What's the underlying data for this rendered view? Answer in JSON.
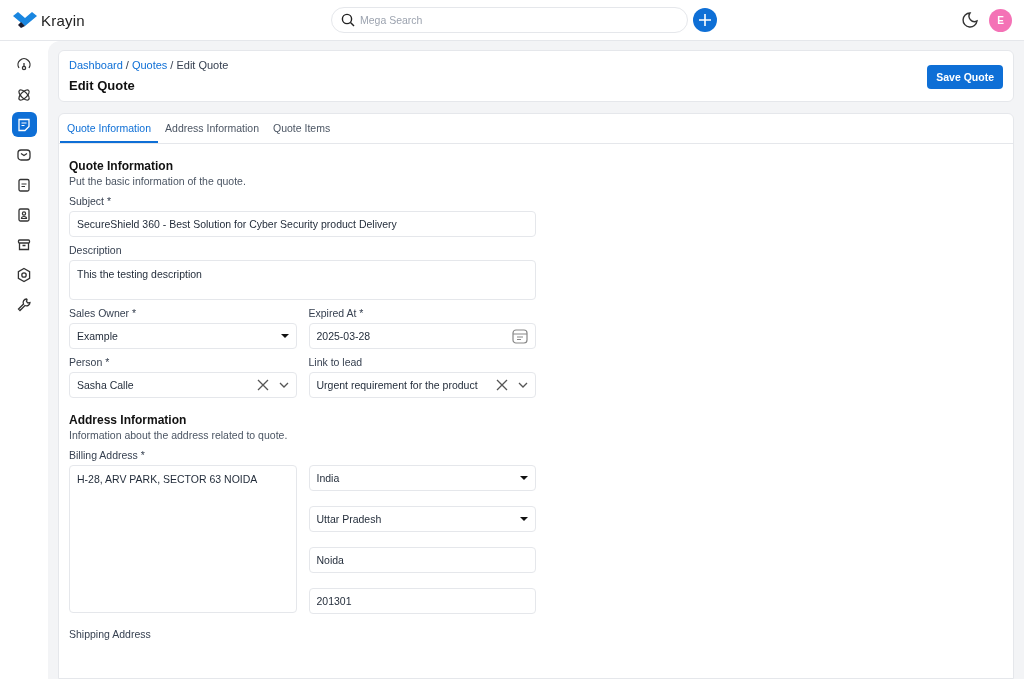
{
  "topbar": {
    "logo": "Krayin",
    "search": {
      "placeholder": "Mega Search"
    },
    "avatar": "E"
  },
  "sidebar": {
    "items": [
      {
        "selected": false
      },
      {
        "selected": false
      },
      {
        "selected": true
      },
      {
        "selected": false
      },
      {
        "selected": false
      },
      {
        "selected": false
      },
      {
        "selected": false
      },
      {
        "selected": false
      },
      {
        "selected": false
      }
    ]
  },
  "breadcrumb": [
    {
      "text": "Dashboard",
      "kind": "link"
    },
    {
      "text": "/",
      "kind": "separator"
    },
    {
      "text": "Quotes",
      "kind": "link"
    },
    {
      "text": "/",
      "kind": "separator"
    },
    {
      "text": "Edit Quote",
      "kind": "current"
    }
  ],
  "page_title": "Edit Quote",
  "save_button": "Save Quote",
  "tabs": [
    {
      "label": "Quote Information",
      "selected": true
    },
    {
      "label": "Address Information",
      "selected": false
    },
    {
      "label": "Quote Items",
      "selected": false
    }
  ],
  "quote_section": {
    "title": "Quote Information",
    "subtitle": "Put the basic information of the quote.",
    "rows": [
      [
        {
          "label": "Subject *",
          "kind": "text",
          "value": "SecureShield 360 - Best Solution for Cyber Security product Delivery"
        }
      ],
      [
        {
          "label": "Description",
          "kind": "textarea",
          "value": "This the testing description"
        }
      ],
      [
        {
          "label": "Sales Owner *",
          "kind": "select",
          "value": "Example"
        },
        {
          "label": "Expired At *",
          "kind": "date",
          "value": "2025-03-28"
        }
      ],
      [
        {
          "label": "Person *",
          "kind": "combobox",
          "value": "Sasha Calle"
        },
        {
          "label": "Link to lead",
          "kind": "combobox",
          "value": "Urgent requirement for the product"
        }
      ]
    ]
  },
  "address_section": {
    "title": "Address Information",
    "subtitle": "Information about the address related to quote.",
    "billing": {
      "label": "Billing Address *",
      "value": "H-28, ARV PARK, SECTOR 63 NOIDA",
      "fields": [
        {
          "kind": "select",
          "value": "India"
        },
        {
          "kind": "select",
          "value": "Uttar Pradesh"
        },
        {
          "kind": "text",
          "value": "Noida"
        },
        {
          "kind": "text",
          "value": "201301"
        }
      ]
    },
    "shipping_label": "Shipping Address"
  }
}
